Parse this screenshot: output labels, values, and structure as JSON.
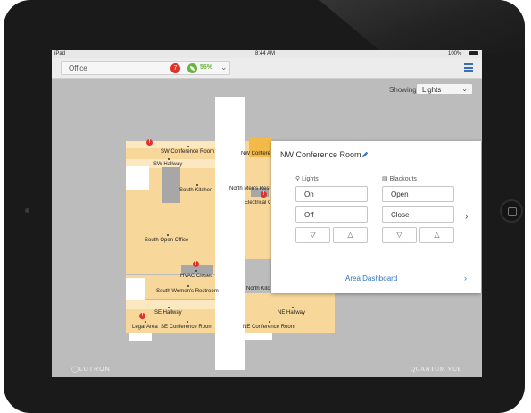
{
  "status_bar": {
    "carrier": "iPad",
    "time": "8:44 AM",
    "battery": "100%"
  },
  "header": {
    "location": "Office",
    "alert_count": "7",
    "energy_savings": "56%"
  },
  "showing": {
    "label": "Showing",
    "selected": "Lights"
  },
  "floorplan": {
    "rooms": {
      "sw_conference": "SW Conference Room",
      "sw_hallway": "SW Hallway",
      "south_kitchen": "South Kitchen",
      "nw_conference": "NW Conference Room",
      "north_mens": "North Men's Restroom",
      "electrical": "Electrical Closet",
      "south_open_office": "South Open Office",
      "hvac_closet": "HVAC Closet",
      "south_womens": "South Women's Restroom",
      "north_kitchen": "North Kitchen",
      "se_hallway": "SE Hallway",
      "ne_hallway": "NE Hallway",
      "legal_area": "Legal Area",
      "se_conference": "SE Conference Room",
      "ne_conference": "NE Conference Room"
    },
    "alert_markers": [
      "!",
      "!",
      "!",
      "!"
    ]
  },
  "popup": {
    "title": "NW Conference Room",
    "lights": {
      "label": "Lights",
      "on": "On",
      "off": "Off",
      "down": "▽",
      "up": "△"
    },
    "blackouts": {
      "label": "Blackouts",
      "open": "Open",
      "close": "Close",
      "down": "▽",
      "up": "△"
    },
    "next": "›",
    "dashboard": {
      "label": "Area Dashboard",
      "chevron": "›"
    }
  },
  "branding": {
    "brand": "LUTRON",
    "product": "QUANTUM VUE"
  },
  "colors": {
    "room": "#f7d79a",
    "hallway": "#fbe8c0",
    "active_room": "#f3b949",
    "alert": "#e0322b",
    "leaf": "#6cb33e",
    "link": "#2f74c0"
  }
}
